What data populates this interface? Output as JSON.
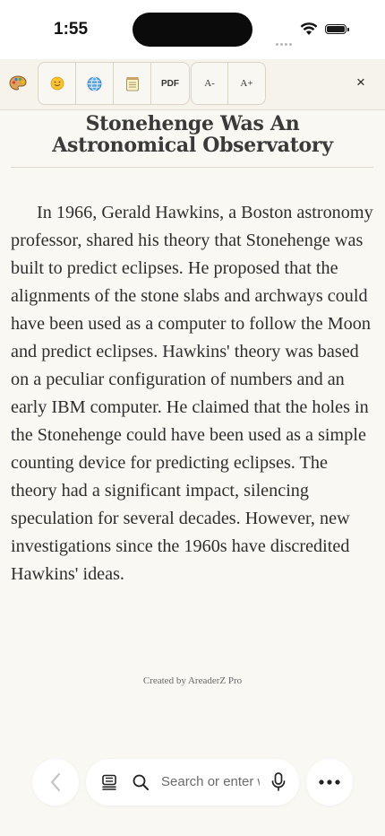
{
  "status_bar": {
    "time": "1:55"
  },
  "toolbar": {
    "buttons": [
      {
        "icon": "palette-icon"
      },
      {
        "icon": "emoji-icon"
      },
      {
        "icon": "globe-icon"
      },
      {
        "icon": "notepad-icon"
      },
      {
        "label": "PDF"
      },
      {
        "label": "A-"
      },
      {
        "label": "A+"
      }
    ],
    "close_label": "×"
  },
  "article": {
    "title_line1": "Stonehenge Was An",
    "title_line2": "Astronomical Observatory",
    "body": "In 1966, Gerald Hawkins, a Boston astronomy professor, shared his theory that Stonehenge was built to predict eclipses. He proposed that the alignments of the stone slabs and archways could have been used as a computer to follow the Moon and predict eclipses. Hawkins' theory was based on a peculiar configuration of numbers and an early IBM computer. He claimed that the holes in the Stonehenge could have been used as a simple counting device for predicting eclipses. The theory had a significant impact, silencing speculation for several decades. However, new investigations since the 1960s have discredited Hawkins' ideas.",
    "credit": "Created by AreaderZ Pro"
  },
  "bottom_bar": {
    "search_placeholder": "Search or enter website"
  }
}
